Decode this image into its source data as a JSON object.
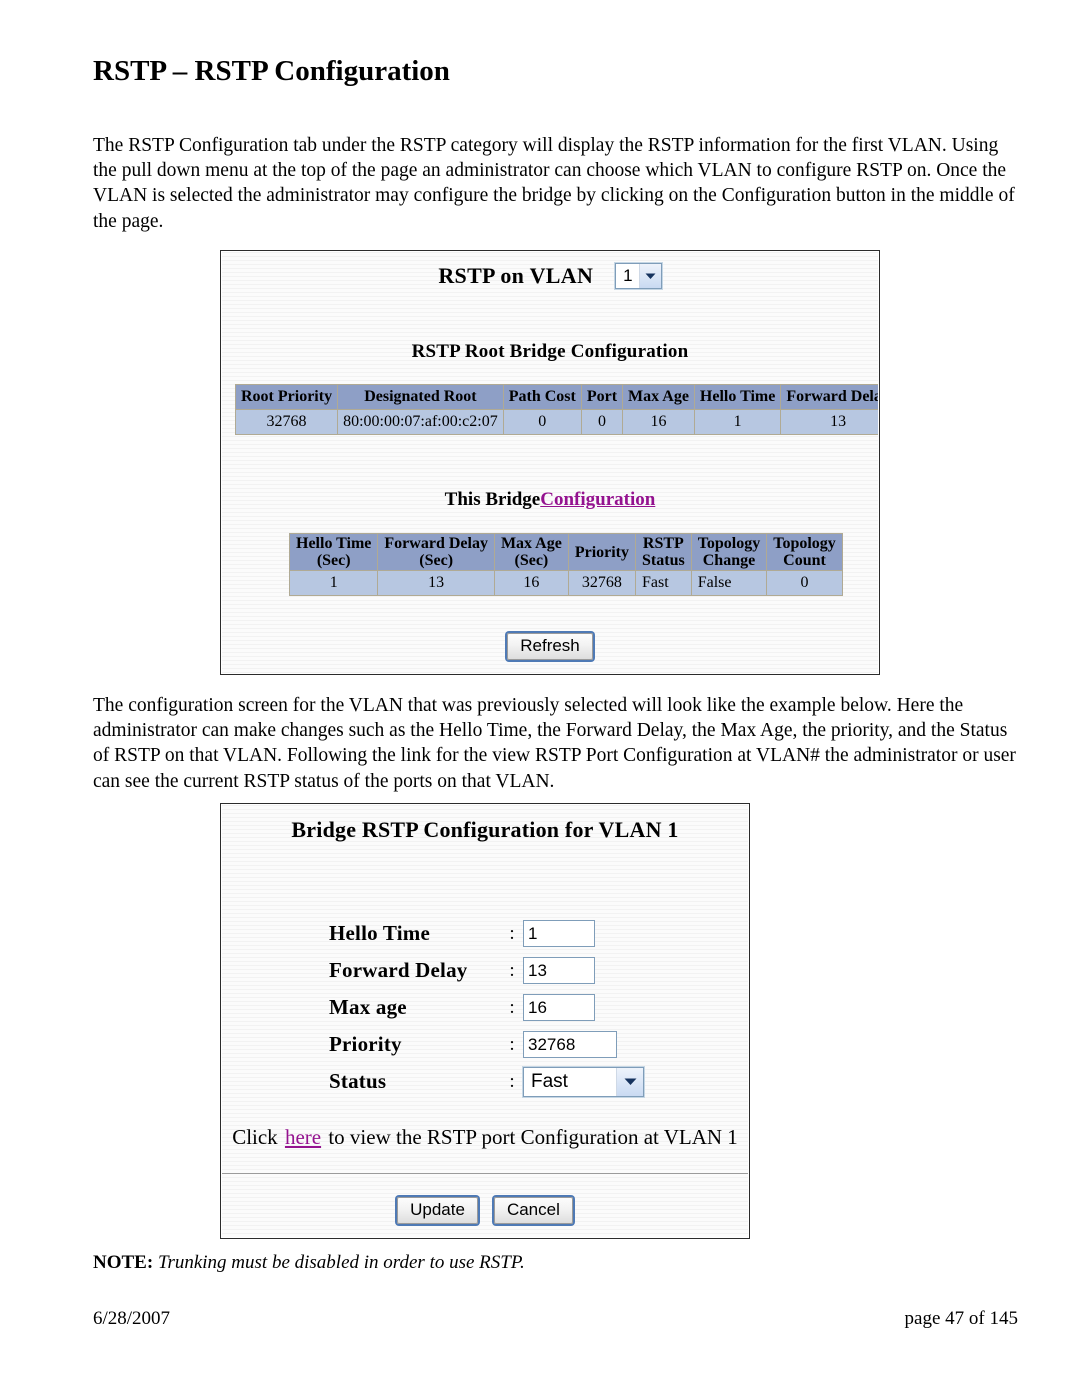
{
  "document": {
    "title": "RSTP – RSTP Configuration",
    "paragraph_1": "The RSTP Configuration tab under the RSTP category will display the RSTP information for the first VLAN.  Using the pull down menu at the top of the page an administrator can choose which VLAN to configure RSTP on.  Once the VLAN is selected the administrator may configure the bridge by clicking on the Configuration button in the middle of the page.",
    "paragraph_2": "The configuration screen for the VLAN that was previously selected will look like the example below.  Here the administrator can make changes such as the Hello Time, the Forward Delay, the Max Age, the priority, and the Status of RSTP on that VLAN.  Following the link for the view RSTP Port Configuration at VLAN# the administrator or user can see the current RSTP status of the ports on that VLAN.",
    "note_prefix": "NOTE:",
    "note_text": "Trunking must be disabled in order to use RSTP.",
    "footer_date": "6/28/2007",
    "footer_page": "page 47 of 145"
  },
  "rstp_status_panel": {
    "vlan_label": "RSTP on VLAN",
    "vlan_select_value": "1",
    "root_bridge_heading": "RSTP Root Bridge Configuration",
    "root_bridge_table": {
      "headers": [
        "Root Priority",
        "Designated Root",
        "Path Cost",
        "Port",
        "Max Age",
        "Hello Time",
        "Forward Delay"
      ],
      "rows": [
        [
          "32768",
          "80:00:00:07:af:00:c2:07",
          "0",
          "0",
          "16",
          "1",
          "13"
        ]
      ]
    },
    "this_bridge_text": "This Bridge",
    "this_bridge_link": "Configuration",
    "this_bridge_table": {
      "headers": [
        {
          "line1": "Hello Time",
          "line2": "(Sec)"
        },
        {
          "line1": "Forward Delay",
          "line2": "(Sec)"
        },
        {
          "line1": "Max Age",
          "line2": "(Sec)"
        },
        {
          "line1": "Priority",
          "line2": ""
        },
        {
          "line1": "RSTP",
          "line2": "Status"
        },
        {
          "line1": "Topology",
          "line2": "Change"
        },
        {
          "line1": "Topology",
          "line2": "Count"
        }
      ],
      "rows": [
        [
          "1",
          "13",
          "16",
          "32768",
          "Fast",
          "False",
          "0"
        ]
      ]
    },
    "refresh_button": "Refresh"
  },
  "bridge_config_panel": {
    "title": "Bridge RSTP Configuration for VLAN 1",
    "fields": [
      {
        "label": "Hello Time",
        "colon": ":",
        "value": "1"
      },
      {
        "label": "Forward Delay",
        "colon": ":",
        "value": "13"
      },
      {
        "label": "Max age",
        "colon": ":",
        "value": "16"
      },
      {
        "label": "Priority",
        "colon": ":",
        "value": "32768"
      }
    ],
    "status_label": "Status",
    "status_colon": ":",
    "status_value": "Fast",
    "click_prefix": "Click",
    "click_link": "here",
    "click_suffix": "to view the RSTP port Configuration at VLAN 1",
    "update_button": "Update",
    "cancel_button": "Cancel"
  },
  "colors": {
    "table_header": "#8e9fc6",
    "table_cell": "#b7c7e1",
    "link_purple": "#94128f",
    "button_focus": "#4f7ab5"
  }
}
